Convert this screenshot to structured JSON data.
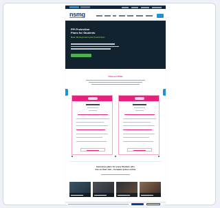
{
  "brand": {
    "logo": "nsmg"
  },
  "hero": {
    "title_line1": "PPI Protection",
    "title_line2": "Plans for Students",
    "highlight": "New: Rent-protect your hostel fees"
  },
  "pricing": {
    "title": "Choose A Plan"
  },
  "bottom": {
    "title_line1": "Insurance plans for every Student, who",
    "title_line2": "live on their own - Compare prices online"
  },
  "colors": {
    "accent": "#ea1f80",
    "brand": "#0c3d8c",
    "hero_bg": "#12222e",
    "cta_green": "#4caf50",
    "link_blue": "#1f8fd6"
  }
}
